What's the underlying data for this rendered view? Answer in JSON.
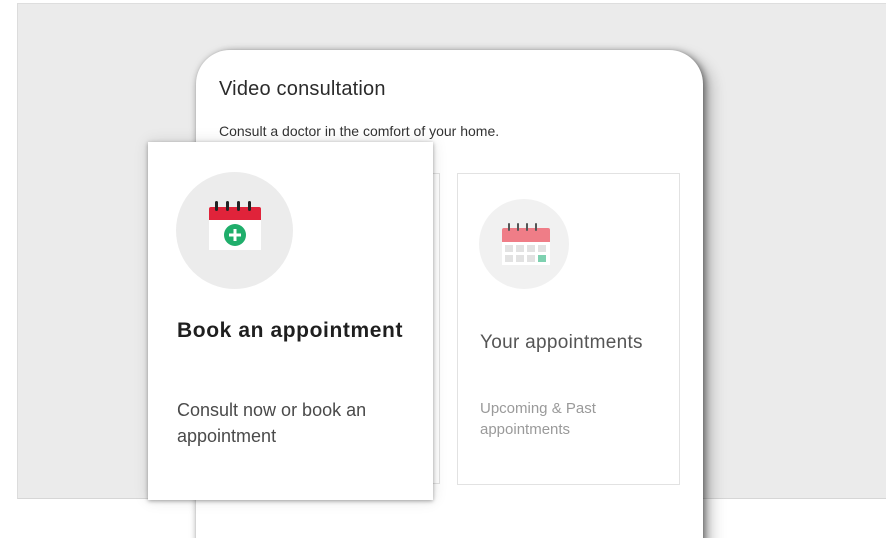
{
  "card": {
    "title": "Video consultation",
    "subtitle": "Consult a doctor in the comfort of your home."
  },
  "tiles": [
    {
      "title": "Book an appointment",
      "description": "Consult now or book an appointment",
      "icon": "calendar-plus-icon",
      "state": "selected"
    },
    {
      "title": "Your appointments",
      "description": "Upcoming & Past appointments",
      "icon": "calendar-icon"
    }
  ],
  "colors": {
    "calendar_header": "#e0233a",
    "plus_green": "#1fae6b",
    "calendar_header_faded": "#ef7d87",
    "highlight_cell": "#7ed1b0",
    "panel_background": "#ebebeb"
  }
}
